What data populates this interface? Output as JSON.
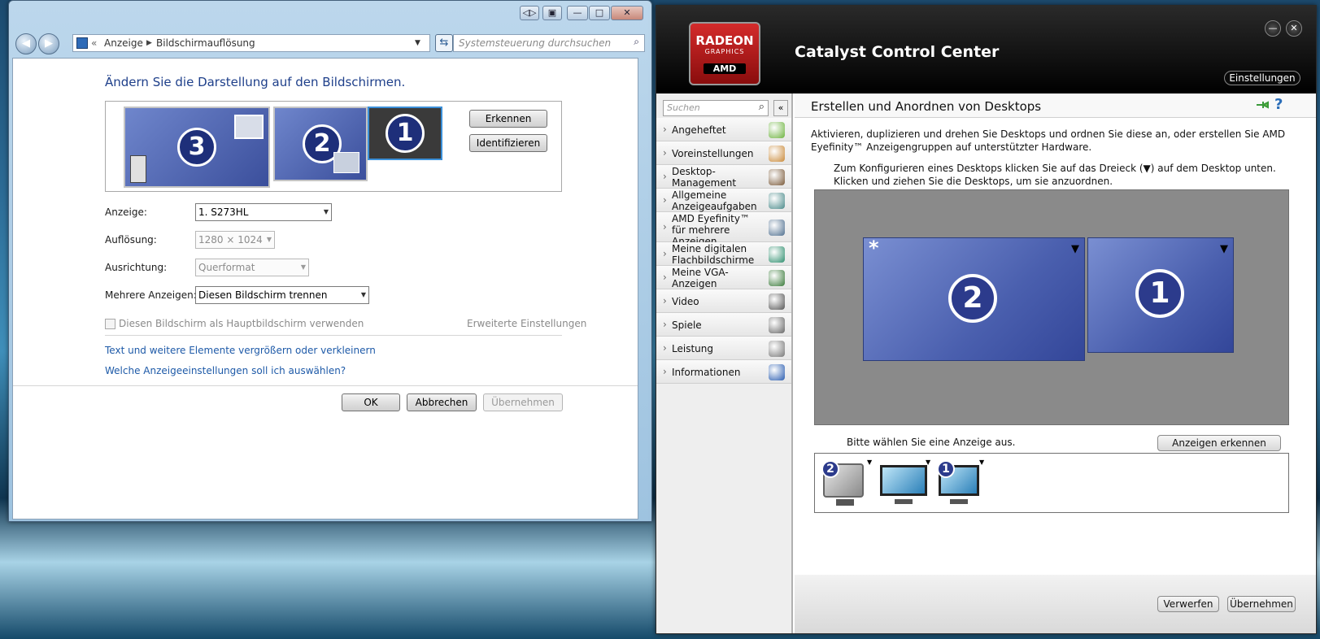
{
  "left_window": {
    "address": {
      "root": "Anzeige",
      "current": "Bildschirmauflösung"
    },
    "search_placeholder": "Systemsteuerung durchsuchen",
    "heading": "Ändern Sie die Darstellung auf den Bildschirmen.",
    "monitors": [
      "3",
      "2",
      "1"
    ],
    "buttons": {
      "detect": "Erkennen",
      "identify": "Identifizieren"
    },
    "fields": {
      "display_label": "Anzeige:",
      "display_value": "1. S273HL",
      "resolution_label": "Auflösung:",
      "resolution_value": "1280 × 1024",
      "orientation_label": "Ausrichtung:",
      "orientation_value": "Querformat",
      "multi_label": "Mehrere Anzeigen:",
      "multi_value": "Diesen Bildschirm trennen"
    },
    "primary_checkbox": "Diesen Bildschirm als Hauptbildschirm verwenden",
    "advanced_link": "Erweiterte Einstellungen",
    "links": [
      "Text und weitere Elemente vergrößern oder verkleinern",
      "Welche Anzeigeeinstellungen soll ich auswählen?"
    ],
    "footer": {
      "ok": "OK",
      "cancel": "Abbrechen",
      "apply": "Übernehmen"
    }
  },
  "ccc": {
    "logo": {
      "brand": "RADEON",
      "sub": "GRAPHICS",
      "maker": "AMD"
    },
    "title": "Catalyst Control Center",
    "settings": "Einstellungen",
    "search_placeholder": "Suchen",
    "nav": [
      {
        "label": "Angeheftet",
        "icon": "pin-icon",
        "color": "#6db33f"
      },
      {
        "label": "Voreinstellungen",
        "icon": "preset-icon",
        "color": "#c98a3a"
      },
      {
        "label": "Desktop-\nManagement",
        "icon": "desktop-management-icon",
        "color": "#7a5a3a"
      },
      {
        "label": "Allgemeine\nAnzeigeaufgaben",
        "icon": "display-tasks-icon",
        "color": "#4a8a8a"
      },
      {
        "label": "AMD Eyefinity™\nfür mehrere\nAnzeigen",
        "icon": "eyefinity-icon",
        "color": "#4f6f8f"
      },
      {
        "label": "Meine digitalen\nFlachbildschirme",
        "icon": "flatscreen-icon",
        "color": "#2f8f6f"
      },
      {
        "label": "Meine VGA-\nAnzeigen",
        "icon": "vga-icon",
        "color": "#3a7a3a"
      },
      {
        "label": "Video",
        "icon": "video-icon",
        "color": "#555555"
      },
      {
        "label": "Spiele",
        "icon": "gamepad-icon",
        "color": "#666666"
      },
      {
        "label": "Leistung",
        "icon": "gauge-icon",
        "color": "#777777"
      },
      {
        "label": "Informationen",
        "icon": "info-icon",
        "color": "#2a5db0"
      }
    ],
    "page_title": "Erstellen und Anordnen von Desktops",
    "desc": "Aktivieren, duplizieren und drehen Sie Desktops und ordnen Sie diese an, oder erstellen Sie AMD Eyefinity™ Anzeigengruppen auf unterstützter Hardware.",
    "instruction": "Zum Konfigurieren eines Desktops klicken Sie auf das Dreieck (▼) auf dem Desktop unten.  Klicken und ziehen Sie die Desktops, um sie anzuordnen.",
    "desktops": [
      {
        "num": "2",
        "marker": "*"
      },
      {
        "num": "1",
        "marker": ""
      }
    ],
    "select_prompt": "Bitte wählen Sie eine Anzeige aus.",
    "detect_button": "Anzeigen erkennen",
    "monitors": [
      "2",
      "",
      "1"
    ],
    "footer": {
      "discard": "Verwerfen",
      "apply": "Übernehmen"
    }
  }
}
